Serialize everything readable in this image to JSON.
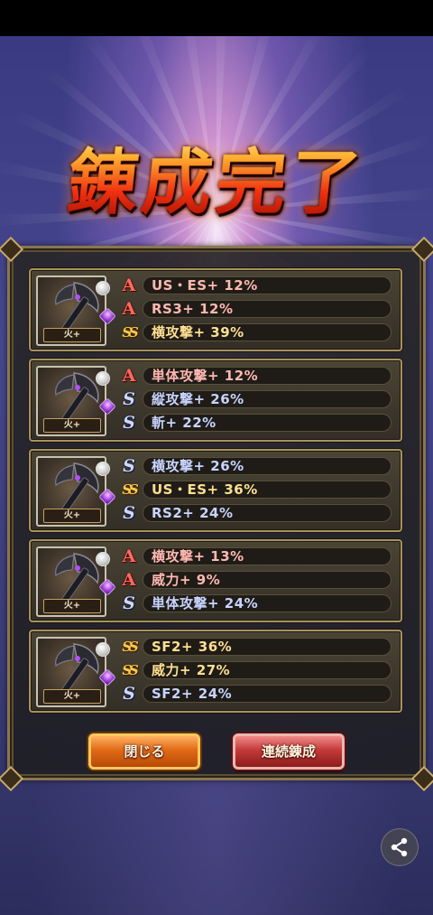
{
  "title": "錬成完了",
  "results": [
    {
      "badge": "火+",
      "lines": [
        {
          "rank": "A",
          "text": "US・ES+ 12%"
        },
        {
          "rank": "A",
          "text": "RS3+ 12%"
        },
        {
          "rank": "SS",
          "text": "横攻撃+ 39%"
        }
      ]
    },
    {
      "badge": "火+",
      "lines": [
        {
          "rank": "A",
          "text": "単体攻撃+ 12%"
        },
        {
          "rank": "S",
          "text": "縦攻撃+ 26%"
        },
        {
          "rank": "S",
          "text": "斬+ 22%"
        }
      ]
    },
    {
      "badge": "火+",
      "lines": [
        {
          "rank": "S",
          "text": "横攻撃+ 26%"
        },
        {
          "rank": "SS",
          "text": "US・ES+ 36%"
        },
        {
          "rank": "S",
          "text": "RS2+ 24%"
        }
      ]
    },
    {
      "badge": "火+",
      "lines": [
        {
          "rank": "A",
          "text": "横攻撃+ 13%"
        },
        {
          "rank": "A",
          "text": "威力+ 9%"
        },
        {
          "rank": "S",
          "text": "単体攻撃+ 24%"
        }
      ]
    },
    {
      "badge": "火+",
      "lines": [
        {
          "rank": "SS",
          "text": "SF2+ 36%"
        },
        {
          "rank": "SS",
          "text": "威力+ 27%"
        },
        {
          "rank": "S",
          "text": "SF2+ 24%"
        }
      ]
    }
  ],
  "buttons": {
    "close": "閉じる",
    "continuous": "連続錬成"
  },
  "icons": {
    "share": "share-icon",
    "weapon": "axe-weapon-icon"
  },
  "colors": {
    "rank_a": "#ff6a60",
    "rank_s": "#cfd8ff",
    "rank_ss": "#ffc94a",
    "close_button": "#e06a16",
    "continuous_button": "#c43a3a"
  }
}
